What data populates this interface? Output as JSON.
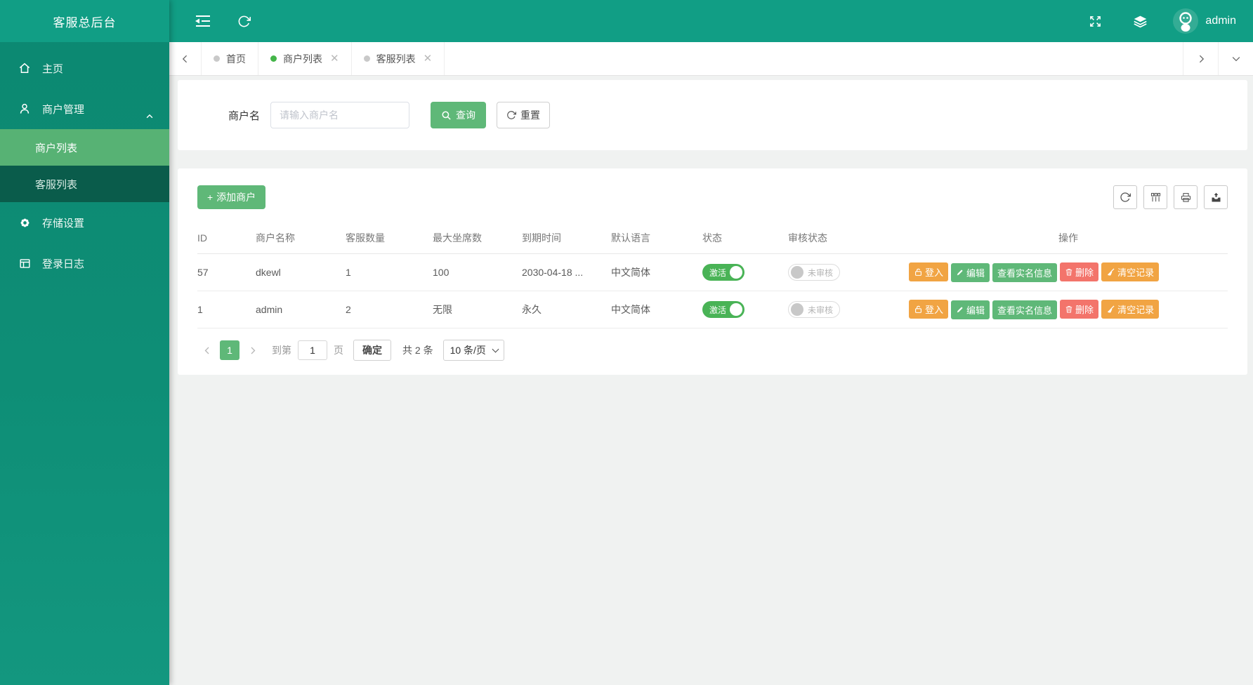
{
  "app": {
    "title": "客服总后台",
    "username": "admin"
  },
  "sidebar": {
    "items": [
      {
        "label": "主页",
        "icon": "home-icon"
      },
      {
        "label": "商户管理",
        "icon": "user-icon",
        "expanded": true,
        "children": [
          {
            "label": "商户列表",
            "active": true
          },
          {
            "label": "客服列表",
            "active": false
          }
        ]
      },
      {
        "label": "存储设置",
        "icon": "gear-icon"
      },
      {
        "label": "登录日志",
        "icon": "login-log-icon"
      }
    ]
  },
  "tabs": [
    {
      "label": "首页",
      "active": false,
      "closable": false
    },
    {
      "label": "商户列表",
      "active": true,
      "closable": true
    },
    {
      "label": "客服列表",
      "active": false,
      "closable": true
    }
  ],
  "search": {
    "label": "商户名",
    "placeholder": "请输入商户名",
    "value": "",
    "query_label": "查询",
    "reset_label": "重置"
  },
  "table": {
    "add_label": "添加商户",
    "columns": [
      "ID",
      "商户名称",
      "客服数量",
      "最大坐席数",
      "到期时间",
      "默认语言",
      "状态",
      "审核状态",
      "操作"
    ],
    "rows": [
      {
        "id": "57",
        "name": "dkewl",
        "agents": "1",
        "max_seats": "100",
        "expire": "2030-04-18 ...",
        "language": "中文简体",
        "status": "激活",
        "status_on": true,
        "audit": "未审核",
        "audit_on": false
      },
      {
        "id": "1",
        "name": "admin",
        "agents": "2",
        "max_seats": "无限",
        "expire": "永久",
        "language": "中文简体",
        "status": "激活",
        "status_on": true,
        "audit": "未审核",
        "audit_on": false
      }
    ],
    "actions": [
      {
        "label": "登入",
        "name": "login-button",
        "style": "orange",
        "icon": "lock-icon"
      },
      {
        "label": "编辑",
        "name": "edit-button",
        "style": "green",
        "icon": "pencil-icon"
      },
      {
        "label": "查看实名信息",
        "name": "view-realname-button",
        "style": "green",
        "icon": ""
      },
      {
        "label": "删除",
        "name": "delete-button",
        "style": "red",
        "icon": "trash-icon"
      },
      {
        "label": "清空记录",
        "name": "clear-records-button",
        "style": "orange",
        "icon": "broom-icon"
      }
    ]
  },
  "pagination": {
    "page": "1",
    "goto_label": "到第",
    "goto_value": "1",
    "unit_label": "页",
    "confirm_label": "确定",
    "total_label": "共 2 条",
    "per_page": "10 条/页"
  },
  "colors": {
    "topbar_teal": "#119e85",
    "sidebar_teal": "#0e8c74",
    "submenu_dark": "#0a5c4b",
    "active_menu_green": "#57b274",
    "button_green": "#5fb878",
    "button_orange": "#f1a443",
    "button_red": "#f3746b",
    "toggle_on_green": "#49b356",
    "active_tab_dot": "#44b549"
  }
}
